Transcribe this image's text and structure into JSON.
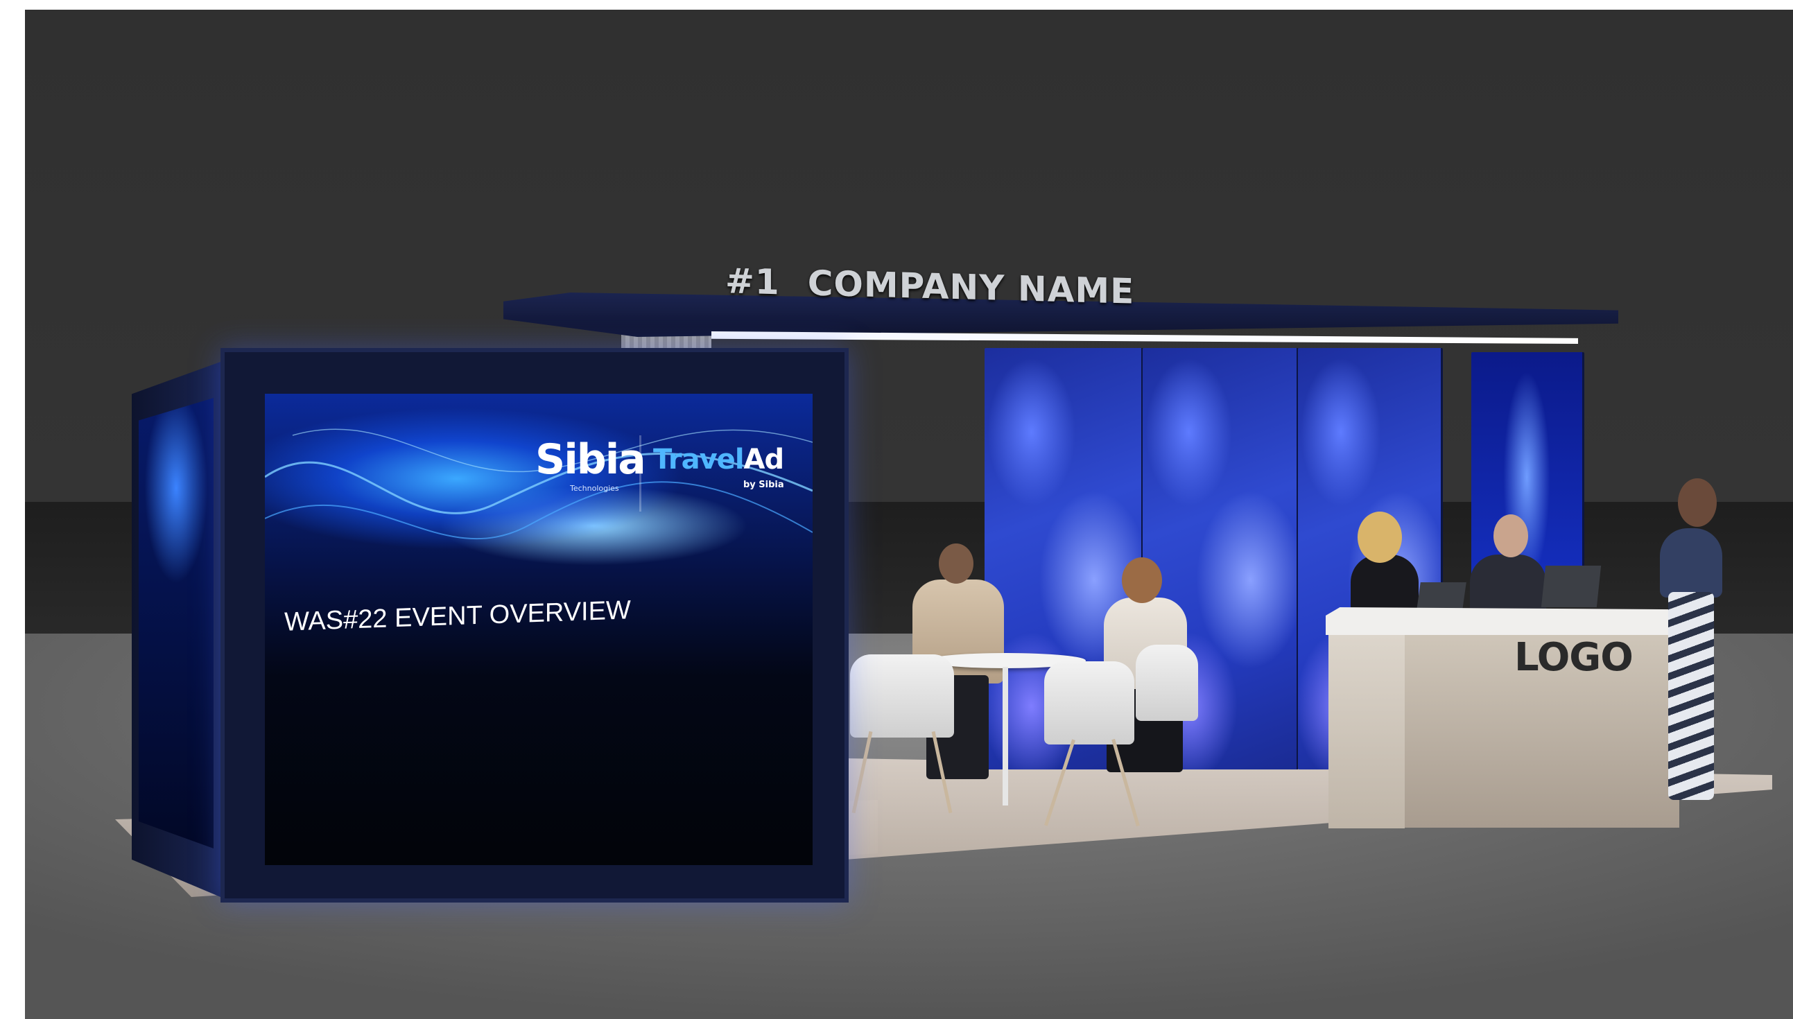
{
  "booth": {
    "canopy_rank": "#1",
    "canopy_name": "COMPANY NAME",
    "counter_logo": "LOGO"
  },
  "screen": {
    "brand_primary": "Sibia",
    "brand_primary_tagline": "Technologies",
    "brand_secondary_a": "Travel",
    "brand_secondary_b": "Ad",
    "brand_secondary_tagline": "by Sibia",
    "headline": "WAS#22 EVENT OVERVIEW"
  },
  "colors": {
    "wall": "#303030",
    "floor": "#7a7a7a",
    "panel_blue": "#2f4ad0",
    "screen_glow": "#3ba8ff",
    "canopy": "#1b2450"
  }
}
